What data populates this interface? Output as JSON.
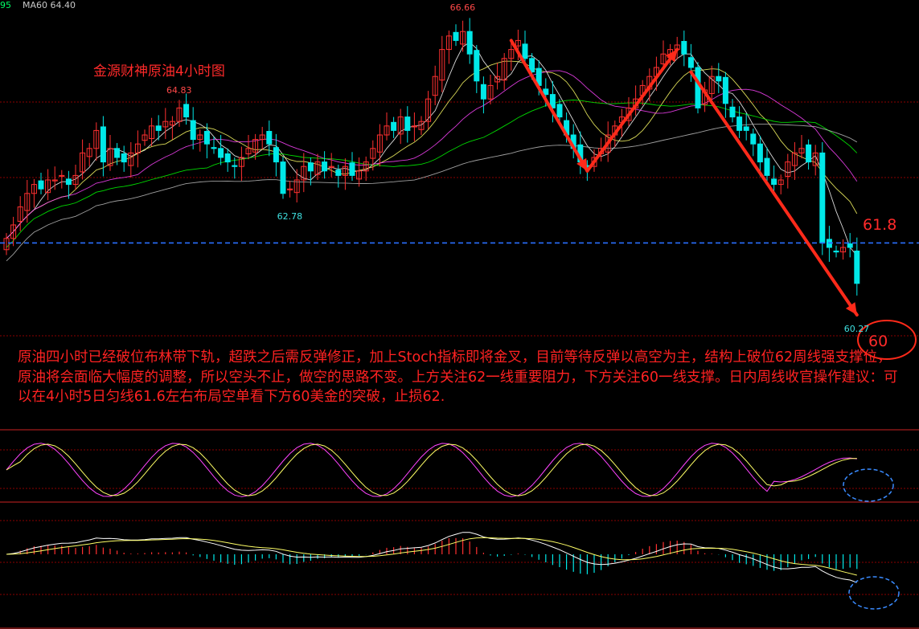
{
  "header": {
    "value1": "95",
    "ma_label": "MA60",
    "ma_value": "64.40"
  },
  "title": "金源财神原油4小时图",
  "commentary": "原油四小时已经破位布林带下轨，超跌之后需反弹修正，加上Stoch指标即将金叉，目前等待反弹以高空为主，结构上破位62周线强支撑位，原油将会面临大幅度的调整，所以空头不止，做空的思路不变。上方关注62一线重要阻力，下方关注60一线支撑。日内周线收官操作建议：可以在4小时5日匀线61.6左右布局空单看下方60美金的突破，止损62.",
  "annotations": {
    "resistance": "61.8",
    "target": "60"
  },
  "colors": {
    "up_candle": "#ff3030",
    "down_candle": "#00e8e8",
    "arrow": "#ff2a1a",
    "resistance_line": "#2a6fff",
    "grid": "#8b0000",
    "ma5": "#ffffff",
    "ma10": "#ffff66",
    "ma20": "#ff44ff",
    "ma30": "#00ff00",
    "ma60": "#bbbbbb",
    "stoch_k": "#ff44ff",
    "stoch_d": "#ffff66",
    "macd_dif": "#ffffff",
    "macd_dea": "#ffff66"
  },
  "chart_data": {
    "type": "candlestick",
    "instrument_title": "金源财神原油4小时图",
    "y_range": [
      59.7,
      67.2
    ],
    "resistance_level": 61.8,
    "target_level": 60,
    "price_labels": [
      {
        "text": "66.66",
        "value": 66.66,
        "index": 66,
        "kind": "high"
      },
      {
        "text": "64.83",
        "value": 64.83,
        "index": 25,
        "kind": "high"
      },
      {
        "text": "62.78",
        "value": 62.78,
        "index": 41,
        "kind": "low"
      },
      {
        "text": "60.27",
        "value": 60.27,
        "index": 123,
        "kind": "low"
      }
    ],
    "trend_arrows": [
      {
        "from": [
          73,
          66.3
        ],
        "to": [
          84,
          63.4
        ]
      },
      {
        "from": [
          84,
          63.4
        ],
        "to": [
          97,
          66.1
        ]
      },
      {
        "from": [
          99,
          65.6
        ],
        "to": [
          123,
          60.2
        ]
      }
    ],
    "closes": [
      61.9,
      62.2,
      62.6,
      62.9,
      63.1,
      63.0,
      63.2,
      63.2,
      63.3,
      63.1,
      63.3,
      63.8,
      63.9,
      64.3,
      63.6,
      63.9,
      63.7,
      63.6,
      63.8,
      64.0,
      64.2,
      64.4,
      64.3,
      64.5,
      64.5,
      64.8,
      64.6,
      64.1,
      64.2,
      64.0,
      63.9,
      63.7,
      63.6,
      63.5,
      63.7,
      63.9,
      64.1,
      64.2,
      64.0,
      63.6,
      62.9,
      63.0,
      63.2,
      63.5,
      63.4,
      63.6,
      63.4,
      63.5,
      63.3,
      63.5,
      63.3,
      63.4,
      63.6,
      63.9,
      64.2,
      64.4,
      64.3,
      64.6,
      64.3,
      64.4,
      64.5,
      65.0,
      65.5,
      66.1,
      66.4,
      66.3,
      66.5,
      66.0,
      65.4,
      65.0,
      65.3,
      65.5,
      65.9,
      66.1,
      66.3,
      65.9,
      65.6,
      65.3,
      65.1,
      64.8,
      64.6,
      64.2,
      63.9,
      63.6,
      63.5,
      63.7,
      63.9,
      64.2,
      64.4,
      64.6,
      64.8,
      65.0,
      65.3,
      65.5,
      65.7,
      66.0,
      66.1,
      66.2,
      66.0,
      65.7,
      64.8,
      65.2,
      65.5,
      65.4,
      64.9,
      64.6,
      64.3,
      64.3,
      64.0,
      63.6,
      63.3,
      63.1,
      63.2,
      63.6,
      63.8,
      63.9,
      63.6,
      63.8,
      61.8,
      61.7,
      61.6,
      61.7,
      61.7,
      60.9
    ],
    "series": [
      {
        "name": "MA60",
        "value": 64.4
      }
    ]
  }
}
